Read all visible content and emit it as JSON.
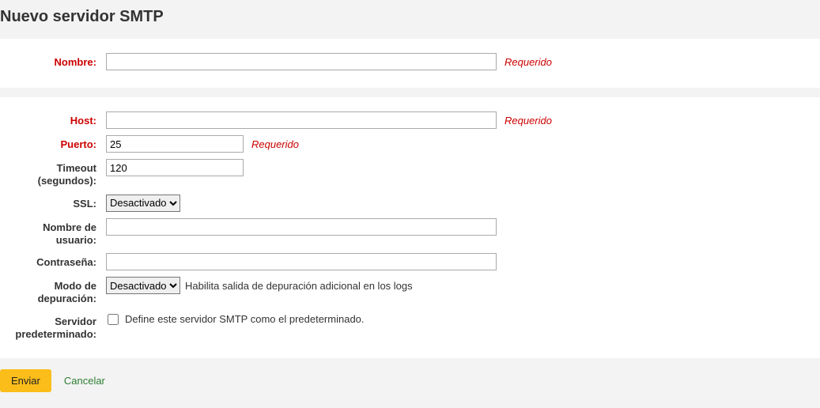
{
  "title": "Nuevo servidor SMTP",
  "required_hint": "Requerido",
  "select_options": {
    "disabled": "Desactivado"
  },
  "fields": {
    "name": {
      "label": "Nombre:",
      "value": ""
    },
    "host": {
      "label": "Host:",
      "value": ""
    },
    "port": {
      "label": "Puerto:",
      "value": "25"
    },
    "timeout": {
      "label": "Timeout (segundos):",
      "value": "120"
    },
    "ssl": {
      "label": "SSL:",
      "value": "Desactivado"
    },
    "username": {
      "label": "Nombre de usuario:",
      "value": ""
    },
    "password": {
      "label": "Contraseña:",
      "value": ""
    },
    "debug": {
      "label": "Modo de depuración:",
      "value": "Desactivado",
      "help": "Habilita salida de depuración adicional en los logs"
    },
    "default": {
      "label": "Servidor predeterminado:",
      "help": "Define este servidor SMTP como el predeterminado."
    }
  },
  "actions": {
    "submit": "Enviar",
    "cancel": "Cancelar"
  }
}
